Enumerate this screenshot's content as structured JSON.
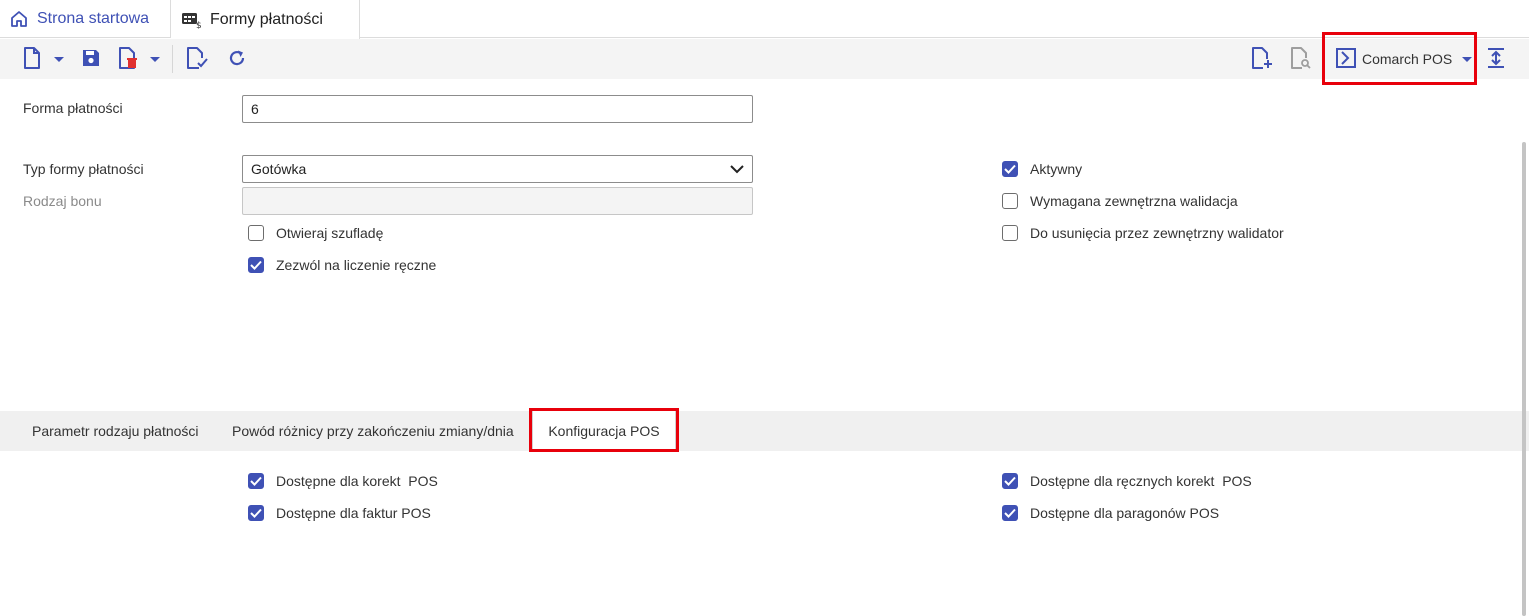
{
  "tabs": {
    "home_label": "Strona startowa",
    "active_label": "Formy płatności"
  },
  "toolbar": {
    "pos_button_label": "Comarch POS"
  },
  "form": {
    "forma_label": "Forma płatności",
    "forma_value": "6",
    "typ_label": "Typ formy płatności",
    "typ_value": "Gotówka",
    "rodzaj_label": "Rodzaj bonu",
    "rodzaj_value": ""
  },
  "checkboxes": {
    "otwieraj": {
      "label": "Otwieraj szufladę",
      "checked": false
    },
    "zezwol": {
      "label": "Zezwól na liczenie ręczne",
      "checked": true
    },
    "aktywny": {
      "label": "Aktywny",
      "checked": true
    },
    "wymagana": {
      "label": "Wymagana zewnętrzna walidacja",
      "checked": false
    },
    "do_usuniecia": {
      "label": "Do usunięcia przez zewnętrzny walidator",
      "checked": false
    }
  },
  "subtabs": {
    "items": [
      {
        "label": "Parametr rodzaju płatności"
      },
      {
        "label": "Powód różnicy przy zakończeniu zmiany/dnia"
      },
      {
        "label": "Konfiguracja POS"
      }
    ],
    "active_index": 2
  },
  "pos_config": {
    "korekt": {
      "label": "Dostępne dla korekt  POS",
      "checked": true
    },
    "faktur": {
      "label": "Dostępne dla faktur POS",
      "checked": true
    },
    "recznych": {
      "label": "Dostępne dla ręcznych korekt  POS",
      "checked": true
    },
    "paragonow": {
      "label": "Dostępne dla paragonów POS",
      "checked": true
    }
  },
  "colors": {
    "accent": "#3f51b5",
    "highlight": "#e8000b"
  }
}
